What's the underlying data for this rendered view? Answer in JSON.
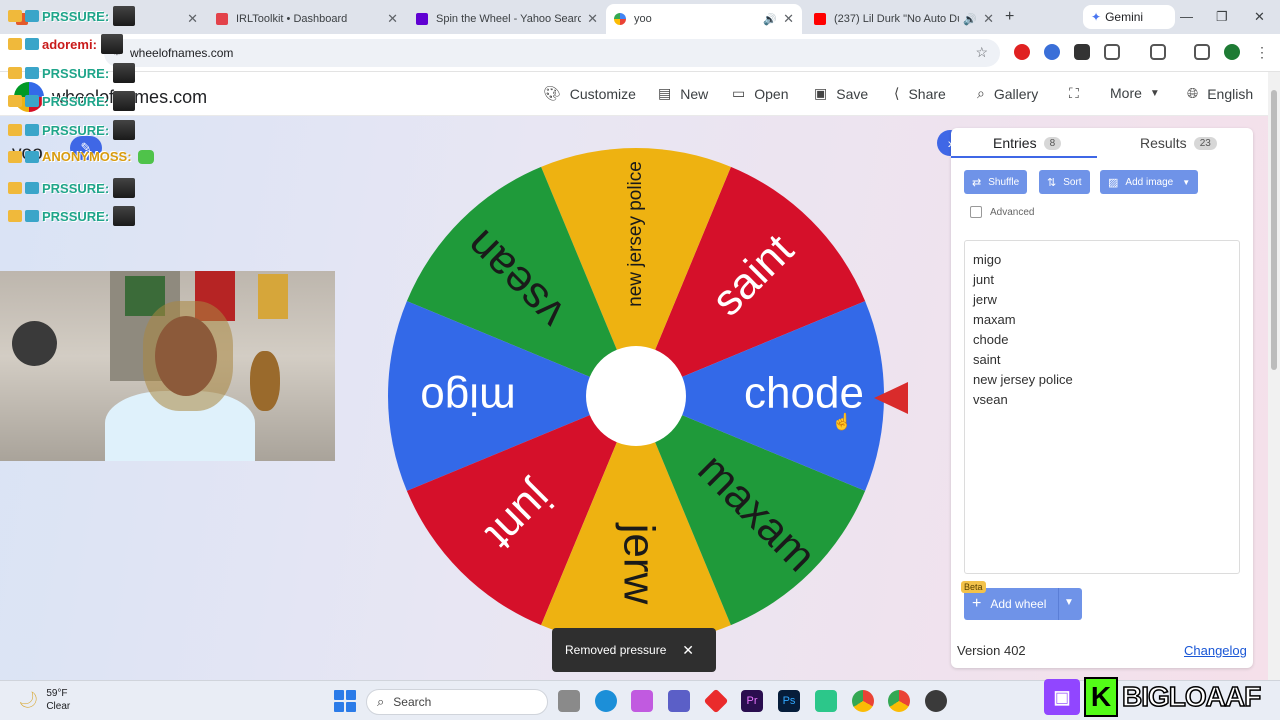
{
  "browser": {
    "tabs": [
      {
        "title": "",
        "favicon_color": "#e45a2b"
      },
      {
        "title": "IRLToolkit • Dashboard",
        "favicon_color": "#e3424a"
      },
      {
        "title": "Spin the Wheel - Yahoo Search",
        "favicon_color": "#6001d2"
      },
      {
        "title": "yoo",
        "favicon_color": "#4285f4"
      },
      {
        "title": "(237) Lil Durk \"No Auto Du",
        "favicon_color": "#ff0000"
      }
    ],
    "gemini_label": "Gemini",
    "url": "wheelofnames.com"
  },
  "site": {
    "logo_text": "wheelofnames.com",
    "nav": {
      "customize": "Customize",
      "new": "New",
      "open": "Open",
      "save": "Save",
      "share": "Share",
      "gallery": "Gallery",
      "more": "More",
      "language": "English"
    },
    "wheel_title": "yoo"
  },
  "wheel": {
    "segments": [
      {
        "label": "saint",
        "color": "#d5102a"
      },
      {
        "label": "new jersey police",
        "color": "#eeb211"
      },
      {
        "label": "vsean",
        "color": "#1f9a3a"
      },
      {
        "label": "migo",
        "color": "#3369e8"
      },
      {
        "label": "junt",
        "color": "#d5102a"
      },
      {
        "label": "jerw",
        "color": "#eeb211"
      },
      {
        "label": "maxam",
        "color": "#1f9a3a"
      },
      {
        "label": "chode",
        "color": "#3369e8"
      }
    ]
  },
  "toast": {
    "message": "Removed pressure"
  },
  "panel": {
    "entries_tab": "Entries",
    "entries_count": "8",
    "results_tab": "Results",
    "results_count": "23",
    "shuffle": "Shuffle",
    "sort": "Sort",
    "add_image": "Add image",
    "advanced": "Advanced",
    "entries": [
      "migo",
      "junt",
      "jerw",
      "maxam",
      "chode",
      "saint",
      "new jersey police",
      "vsean"
    ],
    "beta": "Beta",
    "add_wheel": "Add wheel",
    "version": "Version 402",
    "changelog": "Changelog"
  },
  "chat": {
    "lines": [
      {
        "name": "PRSSURE:",
        "style": "normal"
      },
      {
        "name": "adoremi:",
        "style": "alt"
      },
      {
        "name": "PRSSURE:",
        "style": "normal"
      },
      {
        "name": "PRSSURE:",
        "style": "normal"
      },
      {
        "name": "PRSSURE:",
        "style": "normal"
      },
      {
        "name": "ANONYMOSS:",
        "style": "gold"
      },
      {
        "name": "PRSSURE:",
        "style": "normal"
      },
      {
        "name": "PRSSURE:",
        "style": "normal"
      }
    ]
  },
  "taskbar": {
    "temp": "59°F",
    "condition": "Clear",
    "search": "Search"
  },
  "overlay": {
    "streamer": "BIGLOAAF"
  }
}
